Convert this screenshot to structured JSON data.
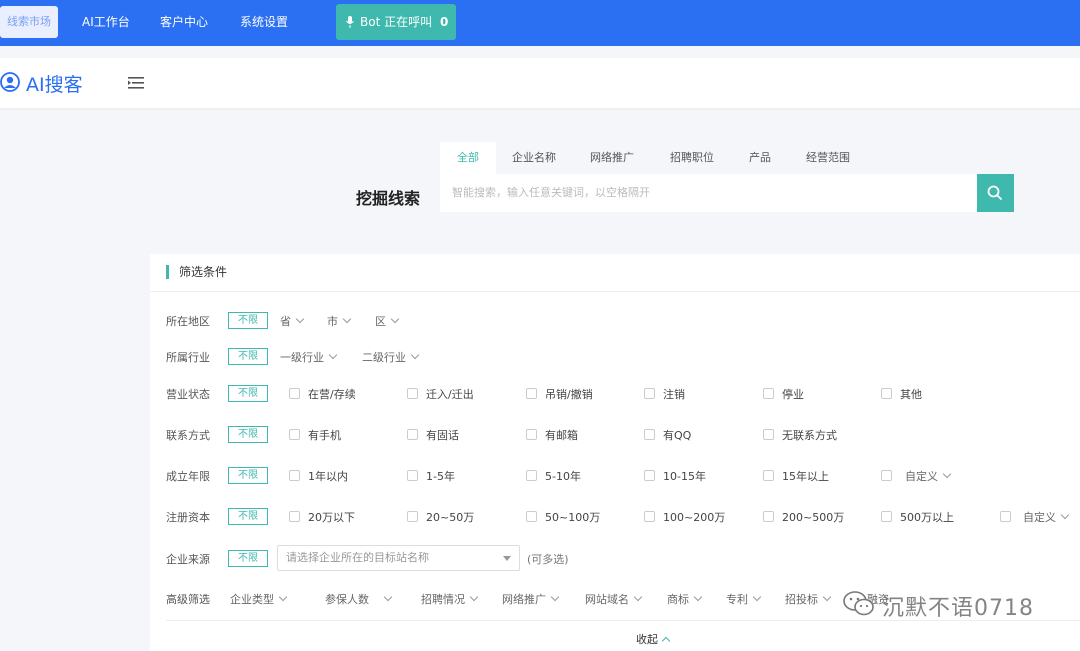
{
  "topnav": {
    "items": [
      "线索市场",
      "AI工作台",
      "客户中心",
      "系统设置"
    ],
    "bot_label": "Bot 正在呼叫",
    "bot_count": "0",
    "colors": {
      "nav_bg": "#2b6ff2",
      "accent": "#3fb8ae"
    }
  },
  "header": {
    "logo_text": "AI搜客"
  },
  "search": {
    "title": "挖掘线索",
    "tabs": [
      "全部",
      "企业名称",
      "网络推广",
      "招聘职位",
      "产品",
      "经营范围"
    ],
    "active_tab": "全部",
    "placeholder": "智能搜索，输入任意关键词，以空格隔开"
  },
  "filter": {
    "title": "筛选条件",
    "unlimited": "不限",
    "region": {
      "label": "所在地区",
      "dropdowns": [
        "省",
        "市",
        "区"
      ]
    },
    "industry": {
      "label": "所属行业",
      "dropdowns": [
        "一级行业",
        "二级行业"
      ]
    },
    "status": {
      "label": "营业状态",
      "options": [
        "在营/存续",
        "迁入/迁出",
        "吊销/撤销",
        "注销",
        "停业",
        "其他"
      ]
    },
    "contact": {
      "label": "联系方式",
      "options": [
        "有手机",
        "有固话",
        "有邮箱",
        "有QQ",
        "无联系方式"
      ]
    },
    "years": {
      "label": "成立年限",
      "options": [
        "1年以内",
        "1-5年",
        "5-10年",
        "10-15年",
        "15年以上"
      ],
      "custom": "自定义"
    },
    "capital": {
      "label": "注册资本",
      "options": [
        "20万以下",
        "20~50万",
        "50~100万",
        "100~200万",
        "200~500万",
        "500万以上"
      ],
      "custom": "自定义"
    },
    "source": {
      "label": "企业来源",
      "placeholder": "请选择企业所在的目标站名称",
      "hint": "(可多选)"
    },
    "advanced": {
      "label": "高级筛选",
      "items": [
        "企业类型",
        "参保人数",
        "招聘情况",
        "网络推广",
        "网站域名",
        "商标",
        "专利",
        "招投标",
        "融资"
      ]
    },
    "collapse": "收起"
  },
  "watermark": "沉默不语0718"
}
